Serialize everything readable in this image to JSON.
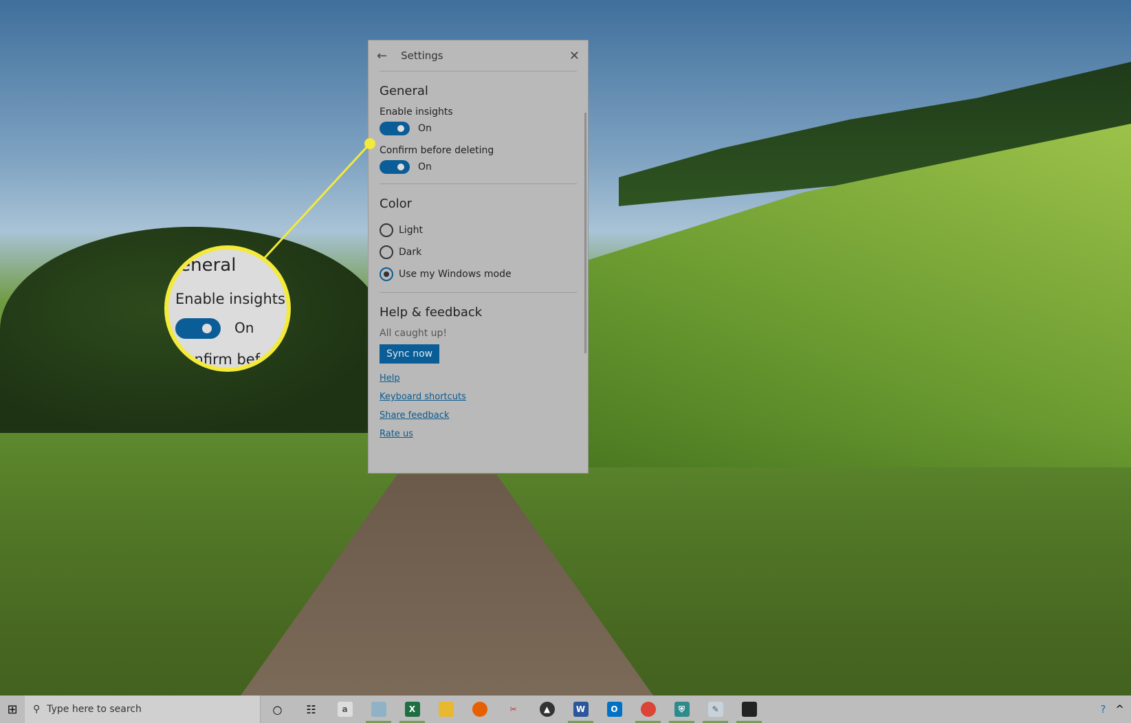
{
  "settings": {
    "title": "Settings",
    "general": {
      "heading": "General",
      "toggles": [
        {
          "label": "Enable insights",
          "state": "On"
        },
        {
          "label": "Confirm before deleting",
          "state": "On"
        }
      ]
    },
    "color": {
      "heading": "Color",
      "options": [
        "Light",
        "Dark",
        "Use my Windows mode"
      ],
      "selected": "Use my Windows mode"
    },
    "help": {
      "heading": "Help & feedback",
      "status": "All caught up!",
      "sync_button": "Sync now",
      "links": [
        "Help",
        "Keyboard shortcuts",
        "Share feedback",
        "Rate us"
      ]
    },
    "accent": "#0a5d96"
  },
  "magnifier": {
    "heading": "General",
    "label": "Enable insights",
    "state": "On",
    "next_label": "Confirm before deleting",
    "highlight": "#f3ea3b"
  },
  "taskbar": {
    "search_placeholder": "Type here to search",
    "apps": [
      {
        "icon": "cortana-icon"
      },
      {
        "icon": "task-view-icon"
      },
      {
        "icon": "app-icon"
      },
      {
        "icon": "notepad-icon"
      },
      {
        "icon": "excel-icon"
      },
      {
        "icon": "file-explorer-icon"
      },
      {
        "icon": "firefox-icon"
      },
      {
        "icon": "snipping-icon"
      },
      {
        "icon": "photos-icon"
      },
      {
        "icon": "word-icon"
      },
      {
        "icon": "outlook-icon"
      },
      {
        "icon": "chrome-icon"
      },
      {
        "icon": "defender-icon"
      },
      {
        "icon": "paint-icon"
      },
      {
        "icon": "sticky-icon"
      }
    ]
  }
}
